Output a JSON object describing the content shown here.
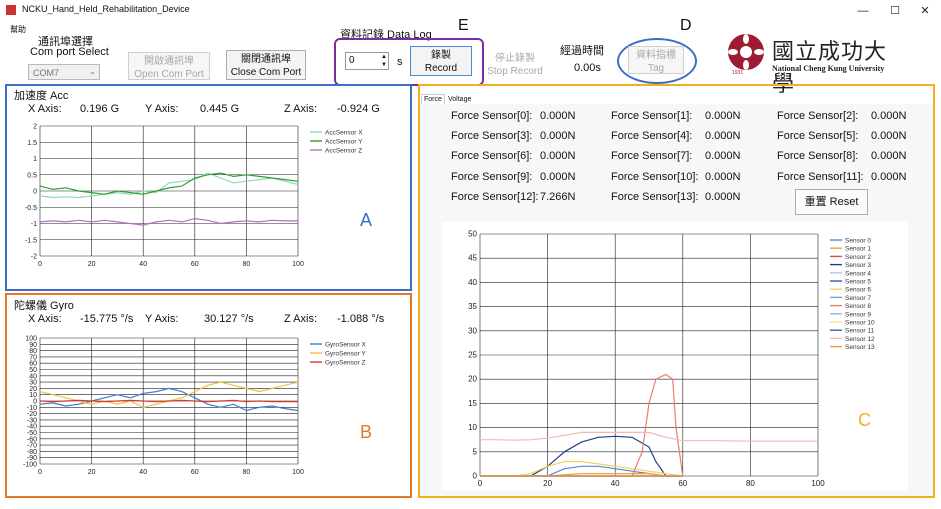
{
  "window": {
    "title": "NCKU_Hand_Held_Rehabilitation_Device",
    "minimize": "—",
    "maximize": "☐",
    "close": "✕"
  },
  "menu": {
    "help": "幫助"
  },
  "comport": {
    "title_zh": "通訊埠選擇",
    "title_en": "Com port Select",
    "selected": "COM7",
    "open_zh": "開啟通訊埠",
    "open_en": "Open Com Port",
    "close_zh": "關閉通訊埠",
    "close_en": "Close Com Port"
  },
  "datalog": {
    "title": "資料記錄  Data Log",
    "interval_value": "0",
    "unit": "s",
    "record_zh": "錄製",
    "record_en": "Record",
    "stop_zh": "停止錄製",
    "stop_en": "Stop Record",
    "elapsed_label": "經過時間",
    "elapsed_value": "0.00s",
    "tag_zh": "資料指標",
    "tag_en": "Tag"
  },
  "logo": {
    "zh": "國立成功大學",
    "en": "National Cheng Kung University",
    "year": "1931"
  },
  "annotations": {
    "a": "A",
    "b": "B",
    "c": "C",
    "d": "D",
    "e": "E"
  },
  "colors": {
    "blue": "#3c6ec8",
    "orange": "#e87722",
    "gold": "#f2b01e",
    "purple": "#7b2f9e",
    "ncku_red": "#9e1b32"
  },
  "acc": {
    "title": "加速度  Acc",
    "x_label": "X Axis:",
    "x_value": "0.196 G",
    "y_label": "Y Axis:",
    "y_value": "0.445 G",
    "z_label": "Z Axis:",
    "z_value": "-0.924 G"
  },
  "gyro": {
    "title": "陀螺儀  Gyro",
    "x_label": "X Axis:",
    "x_value": "-15.775 °/s",
    "y_label": "Y Axis:",
    "y_value": "30.127 °/s",
    "z_label": "Z Axis:",
    "z_value": "-1.088 °/s"
  },
  "tabs": {
    "force": "Force",
    "voltage": "Voltage"
  },
  "force": {
    "sensors": [
      {
        "label": "Force Sensor[0]:",
        "value": "0.000N"
      },
      {
        "label": "Force Sensor[1]:",
        "value": "0.000N"
      },
      {
        "label": "Force Sensor[2]:",
        "value": "0.000N"
      },
      {
        "label": "Force Sensor[3]:",
        "value": "0.000N"
      },
      {
        "label": "Force Sensor[4]:",
        "value": "0.000N"
      },
      {
        "label": "Force Sensor[5]:",
        "value": "0.000N"
      },
      {
        "label": "Force Sensor[6]:",
        "value": "0.000N"
      },
      {
        "label": "Force Sensor[7]:",
        "value": "0.000N"
      },
      {
        "label": "Force Sensor[8]:",
        "value": "0.000N"
      },
      {
        "label": "Force Sensor[9]:",
        "value": "0.000N"
      },
      {
        "label": "Force Sensor[10]:",
        "value": "0.000N"
      },
      {
        "label": "Force Sensor[11]:",
        "value": "0.000N"
      },
      {
        "label": "Force Sensor[12]:",
        "value": "7.266N"
      },
      {
        "label": "Force Sensor[13]:",
        "value": "0.000N"
      }
    ],
    "reset_zh": "重置",
    "reset_en": "Reset"
  },
  "chart_data": [
    {
      "type": "line",
      "id": "acc",
      "xlim": [
        0,
        100
      ],
      "ylim": [
        -2,
        2
      ],
      "xticks": [
        0,
        20,
        40,
        60,
        80,
        100
      ],
      "yticks": [
        -2,
        -1.5,
        -1,
        -0.5,
        0,
        0.5,
        1,
        1.5,
        2
      ],
      "series": [
        {
          "name": "AccSensor X",
          "color": "#8fd9b8",
          "x": [
            0,
            5,
            10,
            15,
            20,
            25,
            30,
            35,
            40,
            45,
            50,
            55,
            60,
            65,
            70,
            75,
            80,
            85,
            90,
            95,
            100
          ],
          "y": [
            -0.15,
            -0.2,
            -0.18,
            -0.2,
            -0.15,
            -0.1,
            -0.05,
            -0.1,
            0,
            -0.05,
            0.25,
            0.3,
            0.35,
            0.55,
            0.4,
            0.25,
            0.3,
            0.35,
            0.4,
            0.3,
            0.2
          ]
        },
        {
          "name": "AccSensor Y",
          "color": "#2e9e2e",
          "x": [
            0,
            5,
            10,
            15,
            20,
            25,
            30,
            35,
            40,
            45,
            50,
            55,
            60,
            65,
            70,
            75,
            80,
            85,
            90,
            95,
            100
          ],
          "y": [
            0.15,
            0.05,
            0.1,
            0.0,
            -0.05,
            -0.1,
            0.0,
            -0.05,
            -0.1,
            0.0,
            0.1,
            0.15,
            0.4,
            0.5,
            0.55,
            0.45,
            0.5,
            0.45,
            0.4,
            0.35,
            0.3
          ]
        },
        {
          "name": "AccSensor Z",
          "color": "#b76cc8",
          "x": [
            0,
            5,
            10,
            15,
            20,
            25,
            30,
            35,
            40,
            45,
            50,
            55,
            60,
            65,
            70,
            75,
            80,
            85,
            90,
            95,
            100
          ],
          "y": [
            -0.95,
            -0.92,
            -0.95,
            -0.9,
            -0.95,
            -0.9,
            -0.95,
            -1.0,
            -1.05,
            -0.95,
            -0.9,
            -0.95,
            -0.85,
            -0.9,
            -1.0,
            -0.95,
            -0.92,
            -0.95,
            -0.9,
            -0.92,
            -0.92
          ]
        }
      ]
    },
    {
      "type": "line",
      "id": "gyro",
      "xlim": [
        0,
        100
      ],
      "ylim": [
        -100,
        100
      ],
      "xticks": [
        0,
        20,
        40,
        60,
        80,
        100
      ],
      "yticks": [
        -100,
        -90,
        -80,
        -70,
        -60,
        -50,
        -40,
        -30,
        -20,
        -10,
        0,
        10,
        20,
        30,
        40,
        50,
        60,
        70,
        80,
        90,
        100
      ],
      "series": [
        {
          "name": "GyroSensor X",
          "color": "#3b7dd8",
          "x": [
            0,
            5,
            10,
            15,
            20,
            25,
            30,
            35,
            40,
            45,
            50,
            55,
            60,
            65,
            70,
            75,
            80,
            85,
            90,
            95,
            100
          ],
          "y": [
            -5,
            -3,
            -8,
            -5,
            0,
            5,
            10,
            5,
            12,
            15,
            20,
            15,
            5,
            -5,
            -10,
            -5,
            -15,
            -10,
            -8,
            -12,
            -15
          ]
        },
        {
          "name": "GyroSensor Y",
          "color": "#f0c040",
          "x": [
            0,
            5,
            10,
            15,
            20,
            25,
            30,
            35,
            40,
            45,
            50,
            55,
            60,
            65,
            70,
            75,
            80,
            85,
            90,
            95,
            100
          ],
          "y": [
            15,
            10,
            5,
            0,
            -5,
            0,
            -5,
            0,
            -10,
            -5,
            0,
            5,
            15,
            25,
            30,
            25,
            20,
            15,
            20,
            25,
            30
          ]
        },
        {
          "name": "GyroSensor Z",
          "color": "#d8392b",
          "x": [
            0,
            5,
            10,
            15,
            20,
            25,
            30,
            35,
            40,
            45,
            50,
            55,
            60,
            65,
            70,
            75,
            80,
            85,
            90,
            95,
            100
          ],
          "y": [
            0,
            -1,
            0,
            1,
            0,
            -1,
            0,
            1,
            0,
            -1,
            0,
            1,
            0,
            -1,
            0,
            1,
            -1,
            0,
            -1,
            -1,
            -1
          ]
        }
      ]
    },
    {
      "type": "line",
      "id": "force",
      "xlim": [
        0,
        100
      ],
      "ylim": [
        0,
        50
      ],
      "xticks": [
        0,
        20,
        40,
        60,
        80,
        100
      ],
      "yticks": [
        0,
        5,
        10,
        15,
        20,
        25,
        30,
        35,
        40,
        45,
        50
      ],
      "series": [
        {
          "name": "Sensor 0",
          "color": "#4e8ad6",
          "x": [
            0,
            10,
            20,
            25,
            30,
            35,
            40,
            45,
            50,
            55,
            60
          ],
          "y": [
            0,
            0,
            0,
            1.5,
            2,
            2,
            1.5,
            1,
            0.5,
            0,
            0
          ]
        },
        {
          "name": "Sensor 1",
          "color": "#f0a040",
          "x": [
            0,
            10,
            20,
            30,
            40,
            50,
            55,
            60
          ],
          "y": [
            0,
            0,
            0,
            0.5,
            0.5,
            0.5,
            0,
            0
          ]
        },
        {
          "name": "Sensor 2",
          "color": "#e04848",
          "x": [
            0,
            60
          ],
          "y": [
            0,
            0
          ]
        },
        {
          "name": "Sensor 3",
          "color": "#1f3f8f",
          "x": [
            0,
            15,
            20,
            25,
            30,
            35,
            40,
            45,
            50,
            52,
            55,
            60
          ],
          "y": [
            0,
            0,
            2,
            5,
            7,
            8,
            8.2,
            8,
            6,
            3,
            0,
            0
          ]
        },
        {
          "name": "Sensor 4",
          "color": "#aacde8",
          "x": [
            0,
            60
          ],
          "y": [
            0,
            0
          ]
        },
        {
          "name": "Sensor 5",
          "color": "#2e5fb0",
          "x": [
            0,
            60
          ],
          "y": [
            0,
            0
          ]
        },
        {
          "name": "Sensor 6",
          "color": "#f7d060",
          "x": [
            0,
            10,
            15,
            20,
            25,
            30,
            35,
            40,
            45,
            50,
            55,
            60
          ],
          "y": [
            0,
            0,
            0.5,
            2,
            3,
            3,
            2.5,
            2,
            1.5,
            1,
            0.5,
            0
          ]
        },
        {
          "name": "Sensor 7",
          "color": "#7a9ed9",
          "x": [
            0,
            60
          ],
          "y": [
            0,
            0
          ]
        },
        {
          "name": "Sensor 8",
          "color": "#e5806a",
          "x": [
            0,
            45,
            48,
            50,
            52,
            55,
            57,
            58,
            60
          ],
          "y": [
            0,
            0,
            5,
            15,
            20,
            21,
            20,
            10,
            0
          ]
        },
        {
          "name": "Sensor 9",
          "color": "#8fb7e6",
          "x": [
            0,
            60
          ],
          "y": [
            0,
            0
          ]
        },
        {
          "name": "Sensor 10",
          "color": "#f6e39a",
          "x": [
            0,
            60
          ],
          "y": [
            0,
            0
          ]
        },
        {
          "name": "Sensor 11",
          "color": "#3461b5",
          "x": [
            0,
            60
          ],
          "y": [
            0,
            0
          ]
        },
        {
          "name": "Sensor 12",
          "color": "#f5b8b0",
          "x": [
            0,
            5,
            10,
            15,
            20,
            30,
            40,
            50,
            55,
            60,
            70,
            80,
            90,
            100
          ],
          "y": [
            7.5,
            7.5,
            7.4,
            7.5,
            7.8,
            9,
            9,
            9,
            8,
            7.3,
            7.3,
            7.2,
            7.2,
            7.2
          ]
        },
        {
          "name": "Sensor 13",
          "color": "#f09a3a",
          "x": [
            0,
            60
          ],
          "y": [
            0,
            0
          ]
        }
      ]
    }
  ]
}
